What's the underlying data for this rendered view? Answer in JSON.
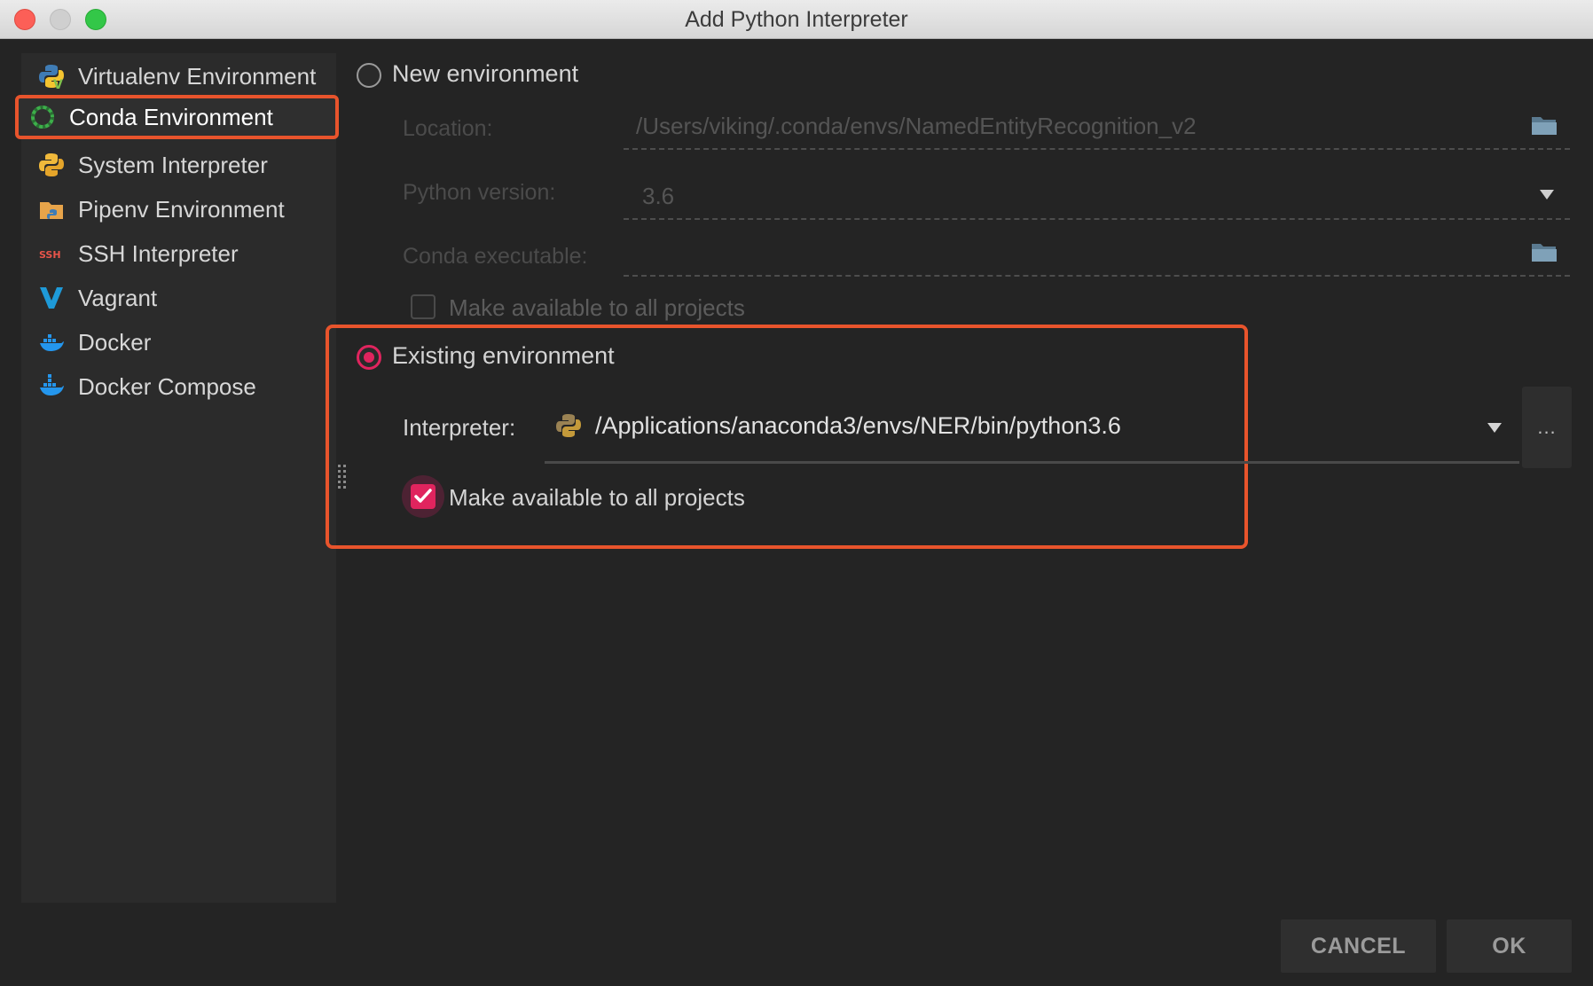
{
  "window": {
    "title": "Add Python Interpreter"
  },
  "sidebar": {
    "items": [
      {
        "label": "Virtualenv Environment",
        "icon": "virtualenv-icon"
      },
      {
        "label": "Conda Environment",
        "icon": "conda-icon",
        "selected": true
      },
      {
        "label": "System Interpreter",
        "icon": "python-icon"
      },
      {
        "label": "Pipenv Environment",
        "icon": "pipenv-folder-icon"
      },
      {
        "label": "SSH Interpreter",
        "icon": "ssh-icon",
        "icon_text": "SSH"
      },
      {
        "label": "Vagrant",
        "icon": "vagrant-icon"
      },
      {
        "label": "Docker",
        "icon": "docker-icon"
      },
      {
        "label": "Docker Compose",
        "icon": "docker-compose-icon"
      }
    ]
  },
  "new_env": {
    "radio_label": "New environment",
    "selected": false,
    "location_label": "Location:",
    "location_value": "/Users/viking/.conda/envs/NamedEntityRecognition_v2",
    "python_version_label": "Python version:",
    "python_version_value": "3.6",
    "conda_exec_label": "Conda executable:",
    "conda_exec_value": "",
    "make_available_label": "Make available to all projects",
    "make_available_checked": false
  },
  "existing_env": {
    "radio_label": "Existing environment",
    "selected": true,
    "interpreter_label": "Interpreter:",
    "interpreter_value": "/Applications/anaconda3/envs/NER/bin/python3.6",
    "more_label": "...",
    "make_available_label": "Make available to all projects",
    "make_available_checked": true
  },
  "buttons": {
    "cancel": "CANCEL",
    "ok": "OK"
  },
  "colors": {
    "accent": "#e0245e",
    "highlight": "#e8542c"
  }
}
